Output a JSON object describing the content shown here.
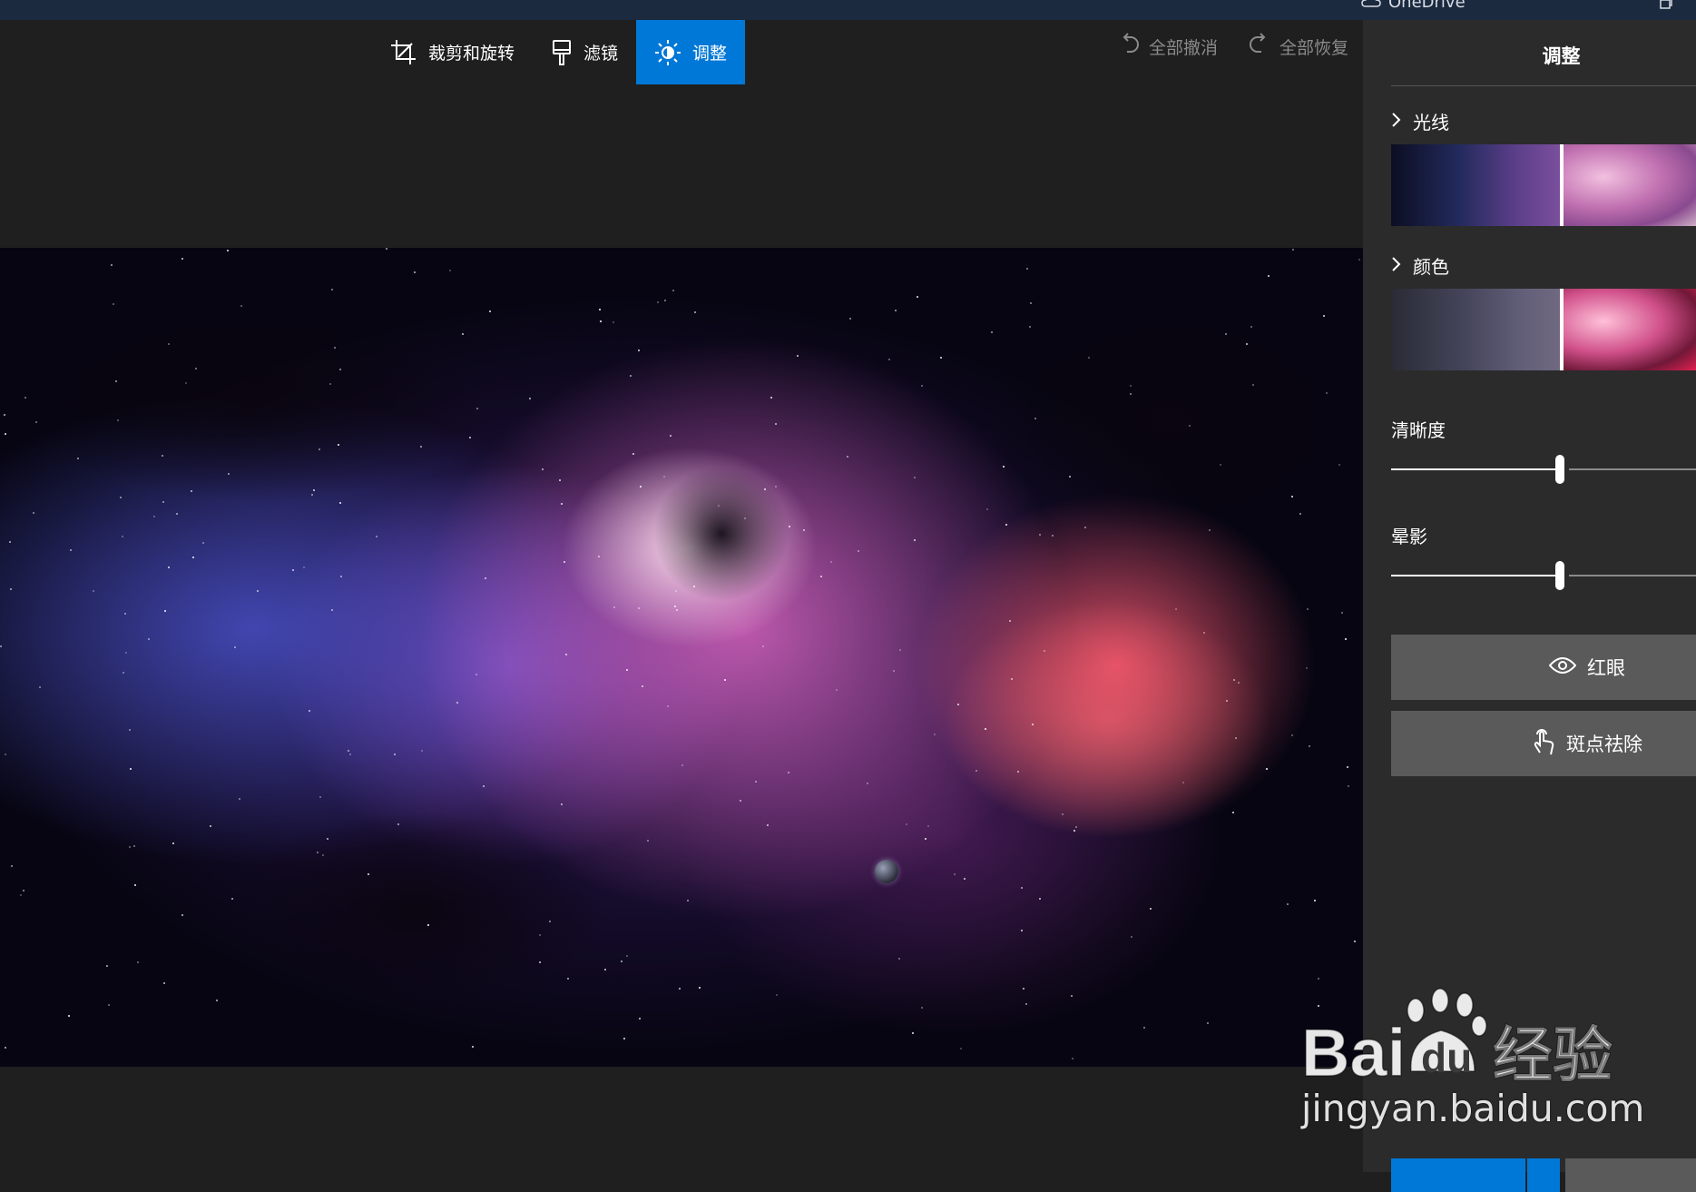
{
  "titlebar": {
    "onedrive_label": "OneDrive"
  },
  "toolbar": {
    "tabs": [
      {
        "label": "裁剪和旋转",
        "icon": "crop-rotate-icon",
        "active": false
      },
      {
        "label": "滤镜",
        "icon": "filter-brush-icon",
        "active": false
      },
      {
        "label": "调整",
        "icon": "brightness-icon",
        "active": true
      }
    ]
  },
  "history": {
    "undo_all_label": "全部撤消",
    "redo_all_label": "全部恢复"
  },
  "panel": {
    "title": "调整",
    "light": {
      "label": "光线"
    },
    "color": {
      "label": "颜色"
    },
    "clarity": {
      "label": "清晰度",
      "value_fraction": 0.5
    },
    "vignette": {
      "label": "晕影",
      "value_fraction": 0.5
    },
    "red_eye": {
      "label": "红眼",
      "icon": "eye-icon"
    },
    "spot_fix": {
      "label": "斑点祛除",
      "icon": "touch-hand-icon"
    }
  },
  "watermark": {
    "brand_text": "Bai du 经验",
    "url": "jingyan.baidu.com"
  },
  "colors": {
    "accent": "#0078d7",
    "panel_bg": "#2b2b2b",
    "editor_bg": "#1f1f1f",
    "button_bg": "#5a5a5a"
  }
}
